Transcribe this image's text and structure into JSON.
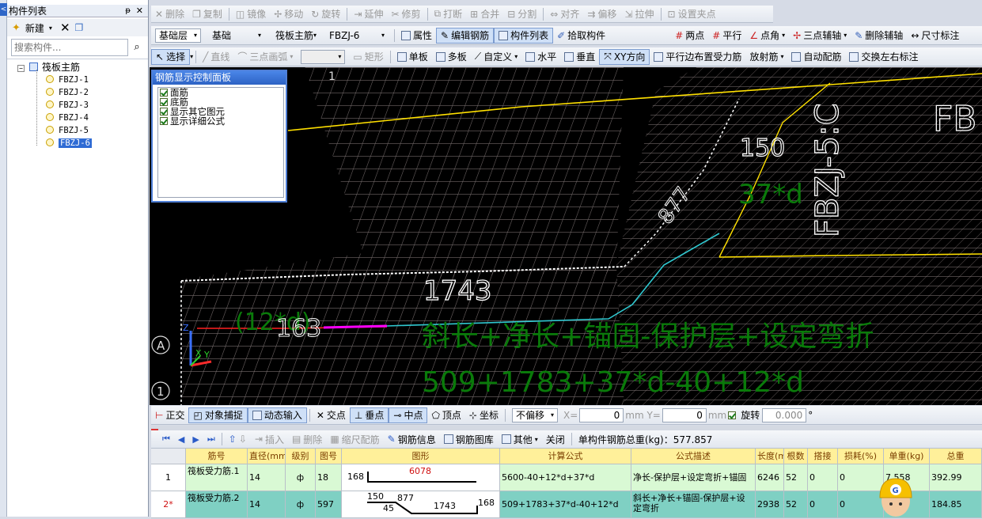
{
  "left_panel": {
    "title": "构件列表",
    "pin": "ᵖ",
    "new_label": "新建",
    "search_placeholder": "搜索构件...",
    "root_label": "筏板主筋",
    "items": [
      "FBZJ-1",
      "FBZJ-2",
      "FBZJ-3",
      "FBZJ-4",
      "FBZJ-5",
      "FBZJ-6"
    ],
    "selected_index": 5
  },
  "toolbar1": {
    "items": [
      "删除",
      "复制",
      "镜像",
      "移动",
      "旋转",
      "延伸",
      "修剪",
      "打断",
      "合并",
      "分割",
      "对齐",
      "偏移",
      "拉伸",
      "设置夹点"
    ]
  },
  "toolbar2": {
    "layer": "基础层",
    "category": "基础",
    "type": "筏板主筋",
    "element": "FBZJ-6",
    "buttons": [
      "属性",
      "编辑钢筋",
      "构件列表",
      "拾取构件"
    ],
    "right_buttons": [
      "两点",
      "平行",
      "点角",
      "三点辅轴",
      "删除辅轴",
      "尺寸标注"
    ]
  },
  "toolbar3": {
    "select_label": "选择",
    "items_disabled": [
      "直线",
      "三点画弧",
      "矩形"
    ],
    "items": [
      "单板",
      "多板",
      "自定义",
      "水平",
      "垂直",
      "XY方向",
      "平行边布置受力筋",
      "放射筋",
      "自动配筋",
      "交换左右标注"
    ]
  },
  "control_panel": {
    "title": "钢筋显示控制面板",
    "options": [
      {
        "label": "面筋",
        "checked": true
      },
      {
        "label": "底筋",
        "checked": true
      },
      {
        "label": "显示其它图元",
        "checked": true
      },
      {
        "label": "显示详细公式",
        "checked": true
      }
    ]
  },
  "viewport": {
    "dim_main": "1743",
    "dim_150": "150",
    "dim_877": "877",
    "label_37d": "37*d",
    "label_12d": "(12*d)",
    "label_163": "163",
    "formula_text": "斜长+净长+锚固-保护层+设定弯折",
    "formula_values": "509+1783+37*d-40+12*d",
    "vertical_label": "FBZJ-5:C",
    "corner_label": "FB",
    "axis_a": "A",
    "axis_1": "1",
    "axis_top": "1",
    "axis_x": "X",
    "axis_y": "Y",
    "axis_z": "Z"
  },
  "snap_bar": {
    "items": [
      "正交",
      "对象捕捉",
      "动态输入",
      "交点",
      "垂点",
      "中点",
      "顶点",
      "坐标"
    ],
    "offset_mode": "不偏移",
    "x_label": "X=",
    "x_value": "0",
    "y_label": "mm Y=",
    "y_value": "0",
    "unit": "mm",
    "rotate_label": "旋转",
    "rotate_value": "0.000",
    "deg": "°"
  },
  "nav_bar": {
    "items_disabled": [
      "插入",
      "删除",
      "缩尺配筋"
    ],
    "items": [
      "钢筋信息",
      "钢筋图库",
      "其他",
      "关闭"
    ],
    "total_weight": "单构件钢筋总重(kg)：577.857"
  },
  "table": {
    "headers": [
      "筋号",
      "直径(mm)",
      "级别",
      "图号",
      "图形",
      "计算公式",
      "公式描述",
      "长度(mm)",
      "根数",
      "搭接",
      "损耗(%)",
      "单重(kg)",
      "总重"
    ],
    "rows": [
      {
        "idx": "1",
        "name": "筏板受力筋.1",
        "dia": "14",
        "grade": "ф",
        "fig": "18",
        "shape_left": "168",
        "shape_top": "6078",
        "formula": "5600-40+12*d+37*d",
        "desc": "净长-保护层+设定弯折+锚固",
        "len": "6246",
        "count": "52",
        "lap": "0",
        "loss": "0",
        "unit_w": "7.558",
        "total": "392.99"
      },
      {
        "idx": "2*",
        "name": "筏板受力筋.2",
        "dia": "14",
        "grade": "ф",
        "fig": "597",
        "shape_a": "150",
        "shape_b": "877",
        "shape_c": "45",
        "shape_d": "1743",
        "shape_e": "168",
        "formula": "509+1783+37*d-40+12*d",
        "desc": "斜长+净长+锚固-保护层+设定弯折",
        "len": "2938",
        "count": "52",
        "lap": "0",
        "loss": "0",
        "unit_w": "",
        "total": "184.85"
      }
    ]
  }
}
